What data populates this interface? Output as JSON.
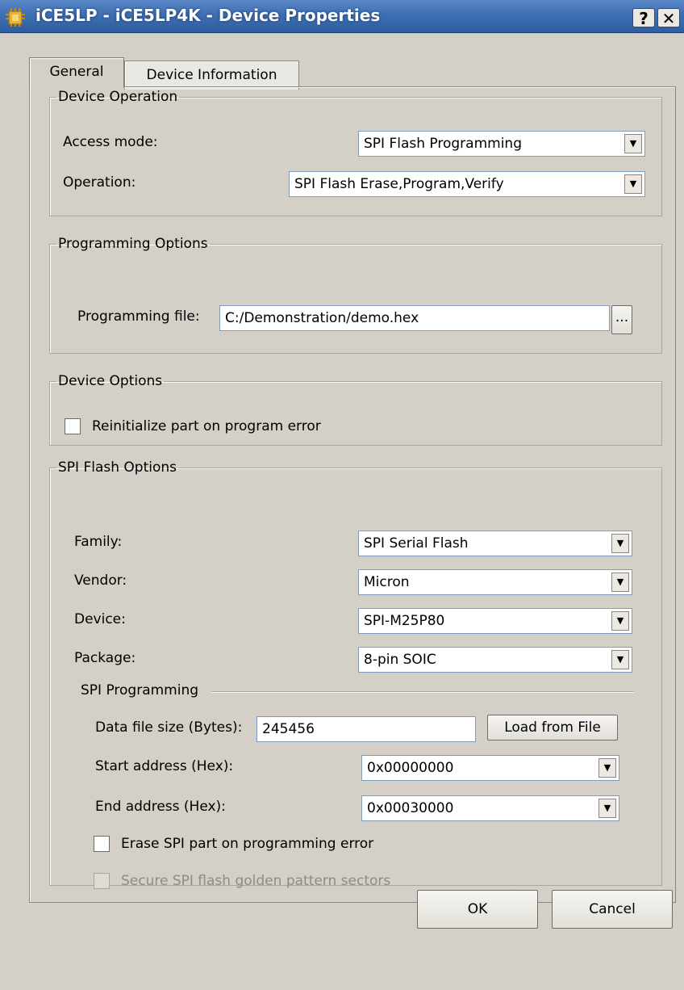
{
  "window": {
    "title": "iCE5LP - iCE5LP4K - Device Properties",
    "help_label": "?",
    "close_label": "✕"
  },
  "tabs": [
    {
      "label": "General",
      "active": true
    },
    {
      "label": "Device Information",
      "active": false
    }
  ],
  "device_operation": {
    "legend": "Device Operation",
    "access_mode_label": "Access mode:",
    "access_mode_value": "SPI Flash Programming",
    "operation_label": "Operation:",
    "operation_value": "SPI Flash Erase,Program,Verify"
  },
  "programming_options": {
    "legend": "Programming Options",
    "file_label": "Programming file:",
    "file_value": "C:/Demonstration/demo.hex",
    "browse_label": "..."
  },
  "device_options": {
    "legend": "Device Options",
    "reinitialize_label": "Reinitialize part on program error",
    "reinitialize_checked": false
  },
  "spi_flash_options": {
    "legend": "SPI Flash Options",
    "family_label": "Family:",
    "family_value": "SPI Serial Flash",
    "vendor_label": "Vendor:",
    "vendor_value": "Micron",
    "device_label": "Device:",
    "device_value": "SPI-M25P80",
    "package_label": "Package:",
    "package_value": "8-pin SOIC",
    "spi_programming": {
      "heading": "SPI Programming",
      "data_size_label": "Data file size (Bytes):",
      "data_size_value": "245456",
      "load_button_label": "Load from File",
      "start_label": "Start address (Hex):",
      "start_value": "0x00000000",
      "end_label": "End address (Hex):",
      "end_value": "0x00030000",
      "erase_label": "Erase SPI part on programming error",
      "erase_checked": false,
      "secure_label": "Secure SPI flash golden pattern sectors",
      "secure_checked": false,
      "secure_enabled": false
    }
  },
  "footer": {
    "ok_label": "OK",
    "cancel_label": "Cancel"
  }
}
